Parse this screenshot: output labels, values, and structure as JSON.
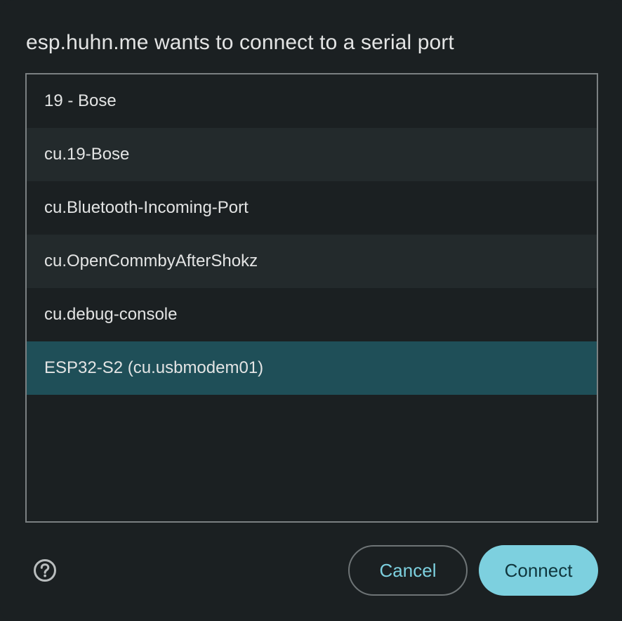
{
  "dialog": {
    "title": "esp.huhn.me wants to connect to a serial port"
  },
  "ports": [
    {
      "label": "19 - Bose",
      "selected": false
    },
    {
      "label": "cu.19-Bose",
      "selected": false
    },
    {
      "label": "cu.Bluetooth-Incoming-Port",
      "selected": false
    },
    {
      "label": "cu.OpenCommbyAfterShokz",
      "selected": false
    },
    {
      "label": "cu.debug-console",
      "selected": false
    },
    {
      "label": "ESP32-S2 (cu.usbmodem01)",
      "selected": true
    }
  ],
  "footer": {
    "help_icon": "help-circle-icon",
    "cancel_label": "Cancel",
    "connect_label": "Connect"
  },
  "colors": {
    "background": "#1b2022",
    "row_alt": "#232a2c",
    "selected_row": "#1f4f58",
    "accent": "#7dd0df"
  }
}
